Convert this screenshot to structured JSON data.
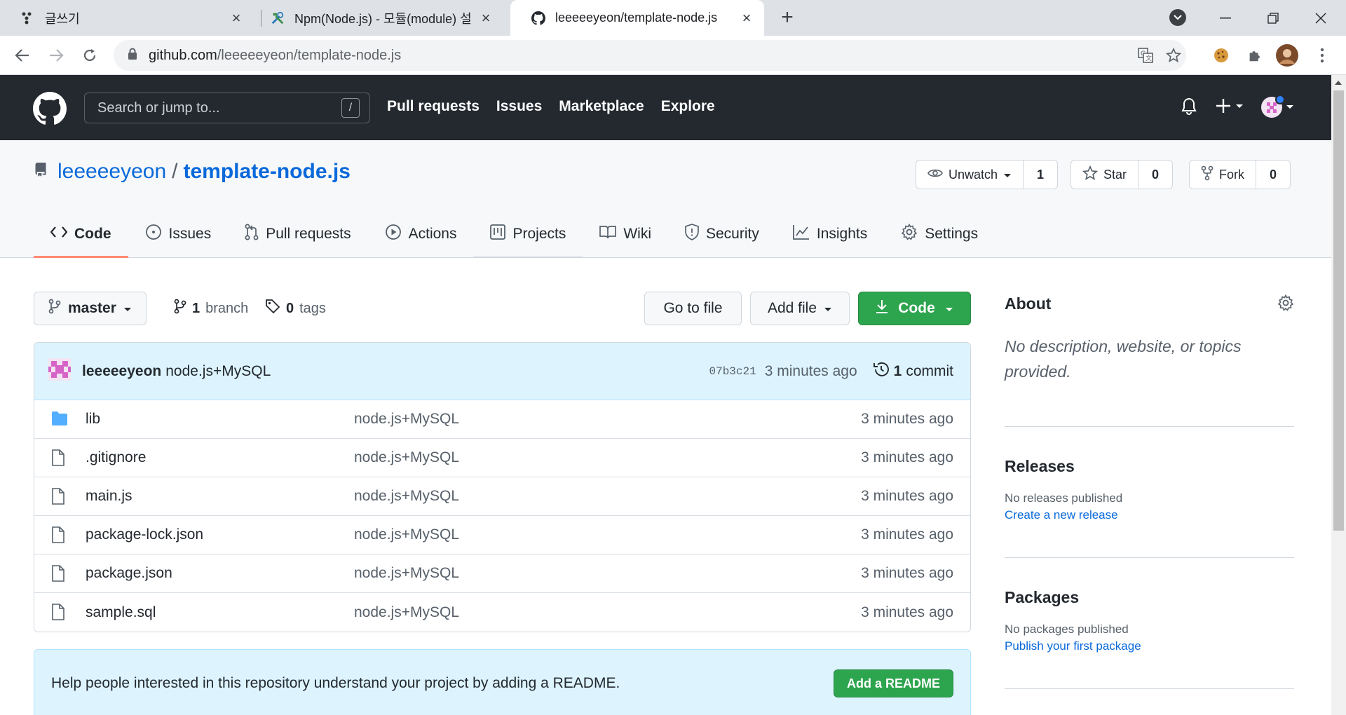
{
  "browser": {
    "tabs": [
      {
        "title": "글쓰기",
        "icon": "dots-icon"
      },
      {
        "title": "Npm(Node.js) - 모듈(module) 설",
        "icon": "tools-icon"
      },
      {
        "title": "leeeeeyeon/template-node.js",
        "icon": "github-icon"
      }
    ],
    "url_domain": "github.com",
    "url_path": "/leeeeeyeon/template-node.js"
  },
  "gh_header": {
    "search_placeholder": "Search or jump to...",
    "search_key": "/",
    "nav": [
      "Pull requests",
      "Issues",
      "Marketplace",
      "Explore"
    ]
  },
  "repo": {
    "owner": "leeeeeyeon",
    "separator": "/",
    "name": "template-node.js",
    "watch_label": "Unwatch",
    "watch_count": "1",
    "star_label": "Star",
    "star_count": "0",
    "fork_label": "Fork",
    "fork_count": "0",
    "tabs": [
      "Code",
      "Issues",
      "Pull requests",
      "Actions",
      "Projects",
      "Wiki",
      "Security",
      "Insights",
      "Settings"
    ]
  },
  "main": {
    "branch": "master",
    "branch_count": "1",
    "branch_label": "branch",
    "tag_count": "0",
    "tag_label": "tags",
    "goto_file": "Go to file",
    "add_file": "Add file",
    "code_button": "Code",
    "commit": {
      "author": "leeeeeyeon",
      "message": "node.js+MySQL",
      "sha": "07b3c21",
      "time": "3 minutes ago",
      "count": "1",
      "count_label": "commit"
    },
    "files": [
      {
        "name": "lib",
        "type": "folder",
        "message": "node.js+MySQL",
        "time": "3 minutes ago"
      },
      {
        "name": ".gitignore",
        "type": "file",
        "message": "node.js+MySQL",
        "time": "3 minutes ago"
      },
      {
        "name": "main.js",
        "type": "file",
        "message": "node.js+MySQL",
        "time": "3 minutes ago"
      },
      {
        "name": "package-lock.json",
        "type": "file",
        "message": "node.js+MySQL",
        "time": "3 minutes ago"
      },
      {
        "name": "package.json",
        "type": "file",
        "message": "node.js+MySQL",
        "time": "3 minutes ago"
      },
      {
        "name": "sample.sql",
        "type": "file",
        "message": "node.js+MySQL",
        "time": "3 minutes ago"
      }
    ],
    "readme_text": "Help people interested in this repository understand your project by adding a README.",
    "readme_button": "Add a README"
  },
  "sidebar": {
    "about_title": "About",
    "about_desc": "No description, website, or topics provided.",
    "releases_title": "Releases",
    "releases_text": "No releases published",
    "releases_link": "Create a new release",
    "packages_title": "Packages",
    "packages_text": "No packages published",
    "packages_link": "Publish your first package"
  },
  "colors": {
    "header_bg": "#24292f",
    "link": "#0969da",
    "green": "#2da44e",
    "tab_underline": "#fd8c73"
  }
}
